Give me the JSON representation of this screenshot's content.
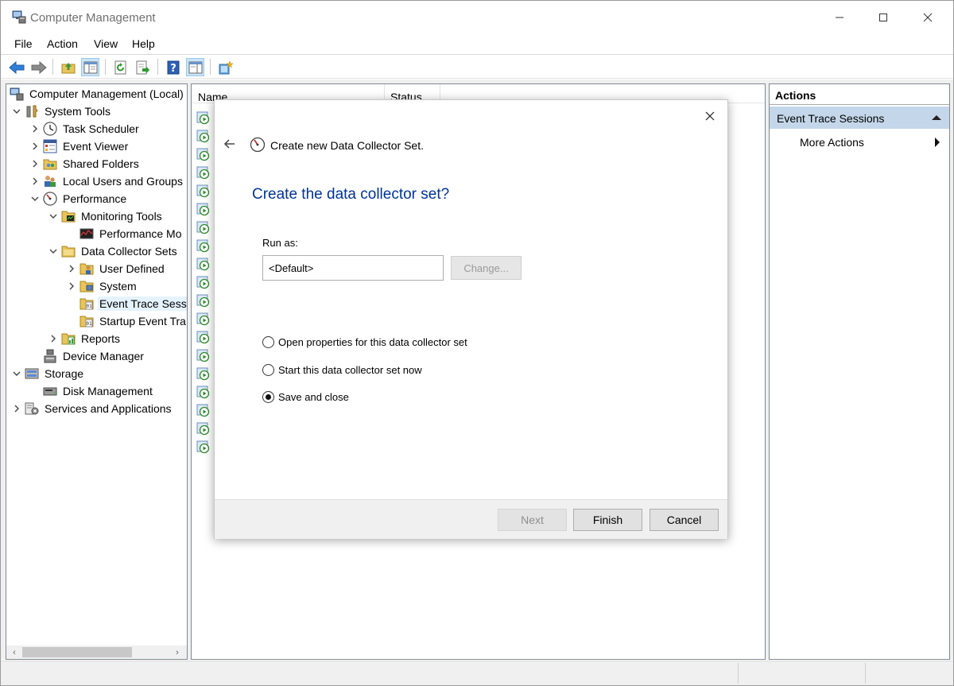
{
  "window": {
    "title": "Computer Management",
    "controls": {
      "minimize": "—",
      "maximize": "☐",
      "close": "✕"
    }
  },
  "menu": [
    "File",
    "Action",
    "View",
    "Help"
  ],
  "toolbar": {
    "icons": [
      "back-arrow-icon",
      "forward-arrow-icon",
      "up-folder-icon",
      "show-hide-tree-icon",
      "refresh-icon",
      "export-list-icon",
      "help-icon",
      "action-pane-icon",
      "new-item-icon"
    ]
  },
  "tree": {
    "items": [
      {
        "label": "Computer Management (Local)",
        "icon": "computer-management-icon",
        "expander": ""
      },
      {
        "label": "System Tools",
        "icon": "system-tools-icon",
        "expander": "⌄"
      },
      {
        "label": "Task Scheduler",
        "icon": "clock-icon",
        "expander": "›"
      },
      {
        "label": "Event Viewer",
        "icon": "event-viewer-icon",
        "expander": "›"
      },
      {
        "label": "Shared Folders",
        "icon": "shared-folders-icon",
        "expander": "›"
      },
      {
        "label": "Local Users and Groups",
        "icon": "users-icon",
        "expander": "›"
      },
      {
        "label": "Performance",
        "icon": "performance-icon",
        "expander": "⌄"
      },
      {
        "label": "Monitoring Tools",
        "icon": "monitoring-folder-icon",
        "expander": "⌄"
      },
      {
        "label": "Performance Mo",
        "icon": "performance-monitor-icon",
        "expander": ""
      },
      {
        "label": "Data Collector Sets",
        "icon": "folder-icon",
        "expander": "⌄"
      },
      {
        "label": "User Defined",
        "icon": "user-defined-folder-icon",
        "expander": "›"
      },
      {
        "label": "System",
        "icon": "system-folder-icon",
        "expander": "›"
      },
      {
        "label": "Event Trace Sessi",
        "icon": "event-trace-folder-icon",
        "expander": ""
      },
      {
        "label": "Startup Event Tra",
        "icon": "startup-trace-folder-icon",
        "expander": ""
      },
      {
        "label": "Reports",
        "icon": "reports-folder-icon",
        "expander": "›"
      },
      {
        "label": "Device Manager",
        "icon": "device-manager-icon",
        "expander": ""
      },
      {
        "label": "Storage",
        "icon": "storage-icon",
        "expander": "⌄"
      },
      {
        "label": "Disk Management",
        "icon": "disk-management-icon",
        "expander": ""
      },
      {
        "label": "Services and Applications",
        "icon": "services-icon",
        "expander": "›"
      }
    ],
    "scroll_left": "‹",
    "scroll_right": "›"
  },
  "list": {
    "columns": [
      "Name",
      "Status"
    ],
    "row_count": 19
  },
  "actions": {
    "title": "Actions",
    "section": "Event Trace Sessions",
    "items": [
      "More Actions"
    ]
  },
  "dialog": {
    "title": "Create new Data Collector Set.",
    "heading": "Create the data collector set?",
    "run_as_label": "Run as:",
    "run_as_value": "<Default>",
    "change_button": "Change...",
    "options": [
      {
        "label": "Open properties for this data collector set",
        "checked": false
      },
      {
        "label": "Start this data collector set now",
        "checked": false
      },
      {
        "label": "Save and close",
        "checked": true
      }
    ],
    "buttons": {
      "next": "Next",
      "finish": "Finish",
      "cancel": "Cancel"
    },
    "close": "✕"
  }
}
